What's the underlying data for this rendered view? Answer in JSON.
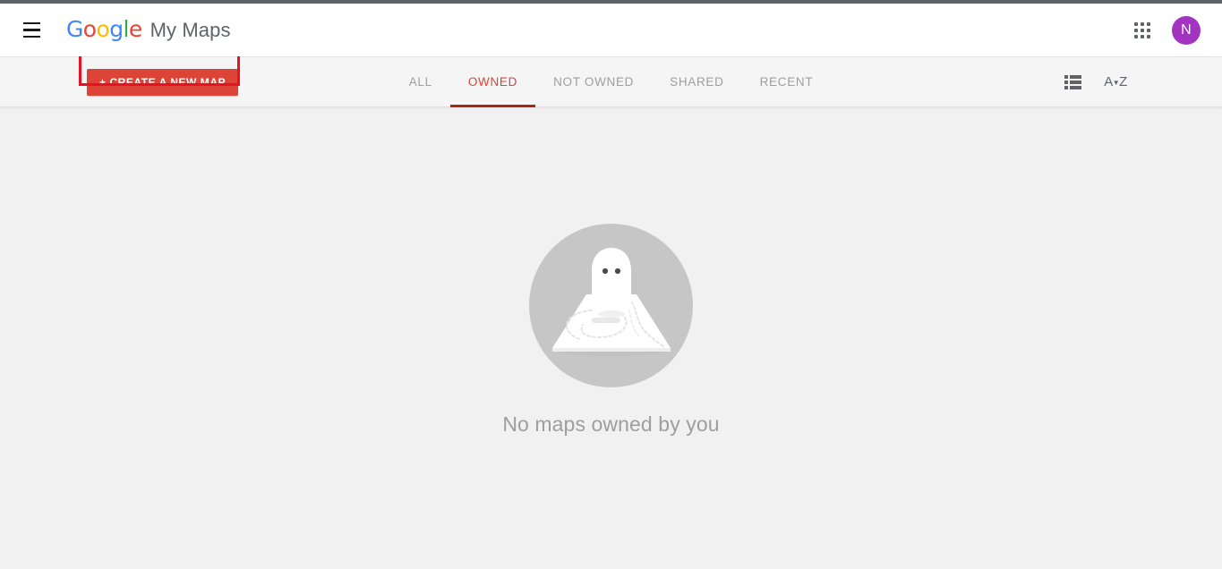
{
  "header": {
    "menu_icon": "hamburger-menu-icon",
    "logo_letters": [
      "G",
      "o",
      "o",
      "g",
      "l",
      "e"
    ],
    "product_name": "My Maps",
    "apps_icon": "apps-grid-icon",
    "avatar_initial": "N",
    "avatar_color": "#a334c0"
  },
  "toolbar": {
    "create_button_label": "+ CREATE A NEW MAP",
    "create_button_color": "#db4437",
    "annotation_color": "#e81123",
    "tabs": [
      {
        "label": "ALL",
        "active": false
      },
      {
        "label": "OWNED",
        "active": true
      },
      {
        "label": "NOT OWNED",
        "active": false
      },
      {
        "label": "SHARED",
        "active": false
      },
      {
        "label": "RECENT",
        "active": false
      }
    ],
    "active_tab_color": "#db4437",
    "list_view_icon": "list-view-icon",
    "sort_icon": "sort-alphabetical-az-icon",
    "sort_icon_label": "AZ"
  },
  "main": {
    "empty_state_text": "No maps owned by you",
    "empty_state_illustration": "ghost-on-map-icon",
    "illustration_circle_color": "#c6c6c6",
    "background_color": "#f1f1f1"
  }
}
